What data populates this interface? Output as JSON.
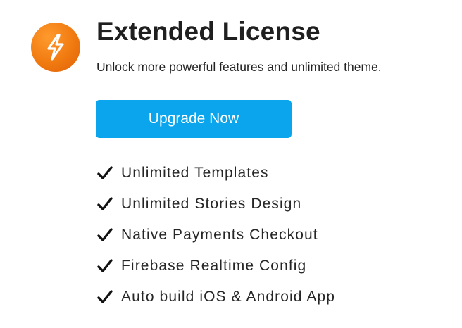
{
  "header": {
    "icon": "lightning-bolt-icon",
    "title": "Extended License",
    "subtitle": "Unlock more powerful features and unlimited theme."
  },
  "cta": {
    "label": "Upgrade Now"
  },
  "features": [
    {
      "icon": "checkmark-icon",
      "label": "Unlimited Templates"
    },
    {
      "icon": "checkmark-icon",
      "label": "Unlimited Stories Design"
    },
    {
      "icon": "checkmark-icon",
      "label": "Native Payments Checkout"
    },
    {
      "icon": "checkmark-icon",
      "label": "Firebase Realtime Config"
    },
    {
      "icon": "checkmark-icon",
      "label": "Auto build iOS & Android App"
    }
  ],
  "colors": {
    "badge": "#f07a10",
    "button": "#0aa5ec",
    "button_text": "#ffffff",
    "text": "#1f1f1f"
  }
}
